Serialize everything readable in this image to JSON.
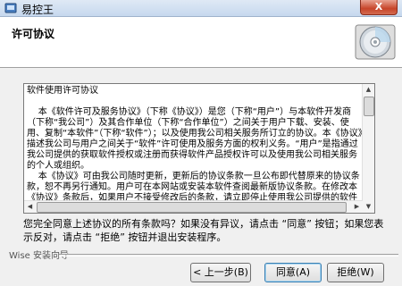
{
  "window": {
    "title": "易控王",
    "close_symbol": "X"
  },
  "header": {
    "title": "许可协议",
    "icon": "cd-disc-icon"
  },
  "license": {
    "text": "软件使用许可协议\n\n    本《软件许可及服务协议》（下称《协议》）是您（下称“用户”）与本软件开发商（下称“我公司”）及其合作单位（下称“合作单位”）之间关于用户下载、安装、使用、复制“本软件”（下称“软件”）；以及使用我公司相关服务所订立的协议。本《协议》描述我公司与用户之间关于“软件”许可使用及服务方面的权利义务。“用户”是指通过我公司提供的获取软件授权或注册而获得软件产品授权许可以及使用我公司相关服务的个人或组织。\n    本《协议》可由我公司随时更新，更新后的协议条款一旦公布即代替原来的协议条款，恕不再另行通知。用户可在本网站或安装本软件查阅最新版协议条款。在修改本《协议》条款后，如果用户不接受修改后的条款，请立即停止使用我公司提供的软件和服务，用户继续使用我公司提供的软件和服务将被视为已接受了修改后的协议。"
  },
  "question": "您完全同意上述协议的所有条款吗？如果没有异议，请点击 “同意” 按钮；如果您表示反对，请点击 “拒绝” 按钮并退出安装程序。",
  "footer": {
    "brand": "Wise 安装向导"
  },
  "buttons": {
    "back": "< 上一步(B)",
    "next": "同意(A)",
    "reject": "拒绝(W)"
  }
}
